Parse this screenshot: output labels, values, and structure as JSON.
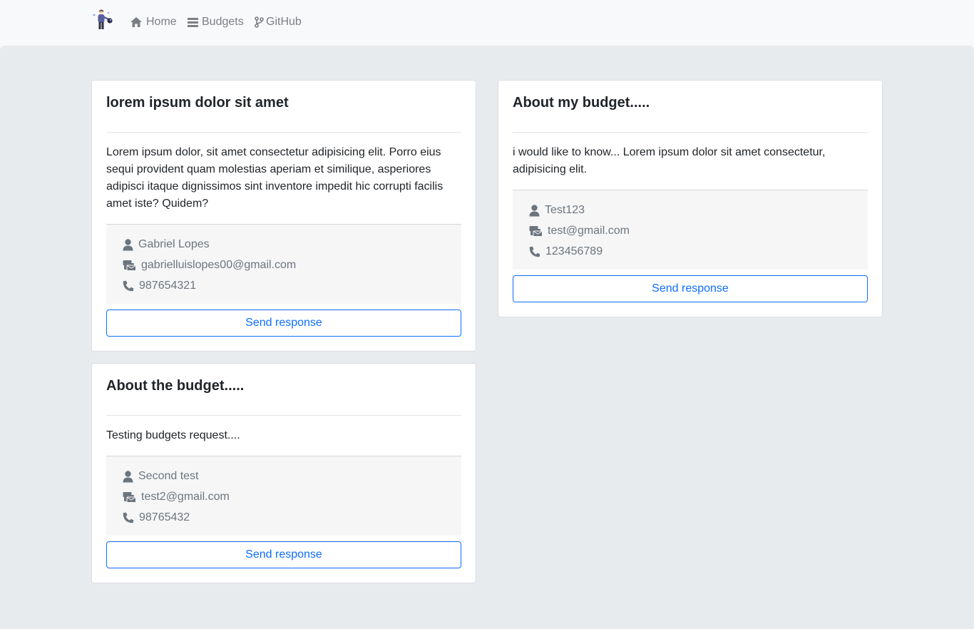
{
  "nav": {
    "links": [
      {
        "label": "Home",
        "icon": "home-icon"
      },
      {
        "label": "Budgets",
        "icon": "list-icon"
      },
      {
        "label": "GitHub",
        "icon": "git-branch-icon"
      }
    ]
  },
  "colors": {
    "accent": "#0d6efd",
    "page_bg": "#e8ebee",
    "navbar_bg": "#f8f9fa",
    "muted_text": "#6c757d"
  },
  "budgets": [
    {
      "title": "lorem ipsum dolor sit amet",
      "message": "Lorem ipsum dolor, sit amet consectetur adipisicing elit. Porro eius sequi provident quam molestias aperiam et similique, asperiores adipisci itaque dignissimos sint inventore impedit hic corrupti facilis amet iste? Quidem?",
      "name": "Gabriel Lopes",
      "email": "gabrielluislopes00@gmail.com",
      "phone": "987654321",
      "button_label": "Send response"
    },
    {
      "title": "About my budget.....",
      "message": "i would like to know... Lorem ipsum dolor sit amet consectetur, adipisicing elit.",
      "name": "Test123",
      "email": "test@gmail.com",
      "phone": "123456789",
      "button_label": "Send response"
    },
    {
      "title": "About the budget.....",
      "message": "Testing budgets request....",
      "name": "Second test",
      "email": "test2@gmail.com",
      "phone": "98765432",
      "button_label": "Send response"
    }
  ]
}
